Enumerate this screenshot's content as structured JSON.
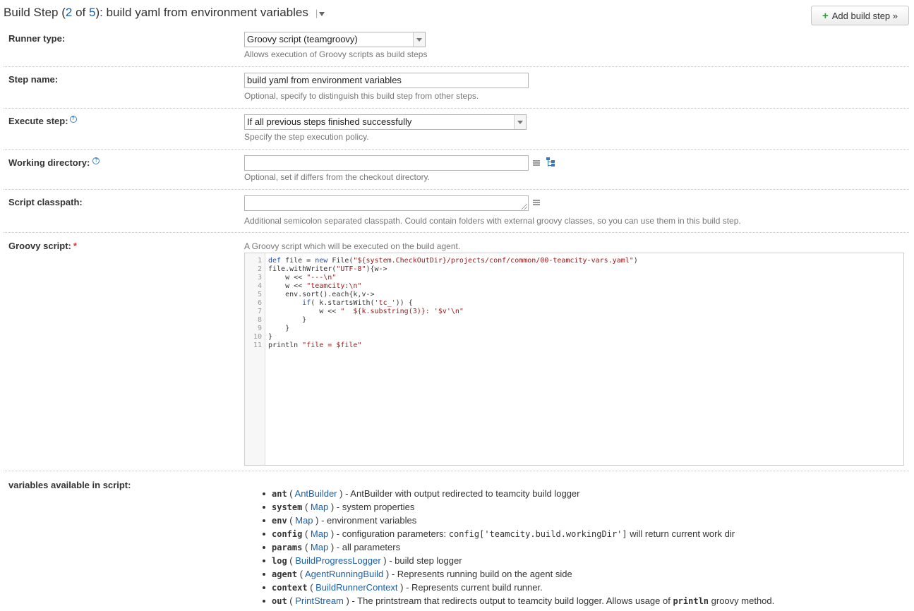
{
  "header": {
    "title_prefix": "Build Step (",
    "step_current": "2",
    "of_text": " of ",
    "step_total": "5",
    "title_suffix": "): build yaml from environment variables",
    "separator": "|",
    "add_button_label": "Add build step »"
  },
  "runner": {
    "label": "Runner type:",
    "value": "Groovy script (teamgroovy)",
    "hint": "Allows execution of Groovy scripts as build steps"
  },
  "step_name": {
    "label": "Step name:",
    "value": "build yaml from environment variables",
    "hint": "Optional, specify to distinguish this build step from other steps."
  },
  "execute_step": {
    "label": "Execute step:",
    "value": "If all previous steps finished successfully",
    "hint": "Specify the step execution policy."
  },
  "working_dir": {
    "label": "Working directory:",
    "value": "",
    "hint": "Optional, set if differs from the checkout directory."
  },
  "classpath": {
    "label": "Script classpath:",
    "value": "",
    "hint": "Additional semicolon separated classpath. Could contain folders with external groovy classes, so you can use them in this build step."
  },
  "groovy_script": {
    "label": "Groovy script:",
    "required_mark": "*",
    "hint": "A Groovy script which will be executed on the build agent.",
    "line_numbers": [
      "1",
      "2",
      "3",
      "4",
      "5",
      "6",
      "7",
      "8",
      "9",
      "10",
      "11"
    ],
    "lines": [
      [
        {
          "t": "def",
          "c": "kw"
        },
        {
          "t": " file = "
        },
        {
          "t": "new",
          "c": "kw"
        },
        {
          "t": " File("
        },
        {
          "t": "\"${system.CheckOutDir}/projects/conf/common/00-teamcity-vars.yaml\"",
          "c": "str"
        },
        {
          "t": ")"
        }
      ],
      [
        {
          "t": "file.withWriter("
        },
        {
          "t": "\"UTF-8\"",
          "c": "str"
        },
        {
          "t": "){w->"
        }
      ],
      [
        {
          "t": "    w << "
        },
        {
          "t": "\"---\\n\"",
          "c": "str"
        }
      ],
      [
        {
          "t": "    w << "
        },
        {
          "t": "\"teamcity:\\n\"",
          "c": "str"
        }
      ],
      [
        {
          "t": "    env.sort().each{k,v->"
        }
      ],
      [
        {
          "t": "        "
        },
        {
          "t": "if",
          "c": "kw"
        },
        {
          "t": "( k.startsWith("
        },
        {
          "t": "'tc_'",
          "c": "str"
        },
        {
          "t": ")) {"
        }
      ],
      [
        {
          "t": "            w << "
        },
        {
          "t": "\"  ${k.substring(3)}: '$v'\\n\"",
          "c": "str"
        }
      ],
      [
        {
          "t": "        }"
        }
      ],
      [
        {
          "t": "    }"
        }
      ],
      [
        {
          "t": "}"
        }
      ],
      [
        {
          "t": "println "
        },
        {
          "t": "\"file = $file\"",
          "c": "str"
        }
      ]
    ]
  },
  "variables": {
    "label": "variables available in script:",
    "items": [
      {
        "name": "ant",
        "open": " ( ",
        "type": "AntBuilder",
        "close": " )",
        "desc": " - AntBuilder with output redirected to teamcity build logger",
        "code": "",
        "desc2": ""
      },
      {
        "name": "system",
        "open": " ( ",
        "type": "Map",
        "close": " )",
        "desc": " - system properties",
        "code": "",
        "desc2": ""
      },
      {
        "name": "env",
        "open": " ( ",
        "type": "Map",
        "close": " )",
        "desc": " - environment variables",
        "code": "",
        "desc2": ""
      },
      {
        "name": "config",
        "open": " ( ",
        "type": "Map",
        "close": " )",
        "desc": " - configuration parameters: ",
        "code": "config['teamcity.build.workingDir']",
        "desc2": " will return current work dir"
      },
      {
        "name": "params",
        "open": " ( ",
        "type": "Map",
        "close": " )",
        "desc": " - all parameters",
        "code": "",
        "desc2": ""
      },
      {
        "name": "log",
        "open": " ( ",
        "type": "BuildProgressLogger",
        "close": " )",
        "desc": " - build step logger",
        "code": "",
        "desc2": ""
      },
      {
        "name": "agent",
        "open": " ( ",
        "type": "AgentRunningBuild",
        "close": " )",
        "desc": " - Represents running build on the agent side",
        "code": "",
        "desc2": ""
      },
      {
        "name": "context",
        "open": " ( ",
        "type": "BuildRunnerContext",
        "close": " )",
        "desc": " - Represents current build runner.",
        "code": "",
        "desc2": ""
      },
      {
        "name": "out",
        "open": " ( ",
        "type": "PrintStream",
        "close": " )",
        "desc": " - The printstream that redirects output to teamcity build logger. Allows usage of ",
        "code_bold": "println",
        "desc2": " groovy method."
      }
    ]
  },
  "icons": {
    "help": "help-icon",
    "list": "list-icon",
    "tree": "tree-icon",
    "plus": "plus-icon",
    "dropdown": "chevron-down-icon"
  },
  "colors": {
    "link": "#1a5fa8",
    "keyword": "#1f4fb0",
    "string": "#a31515",
    "required": "#dd3333",
    "add_icon": "#2e9c3a"
  }
}
